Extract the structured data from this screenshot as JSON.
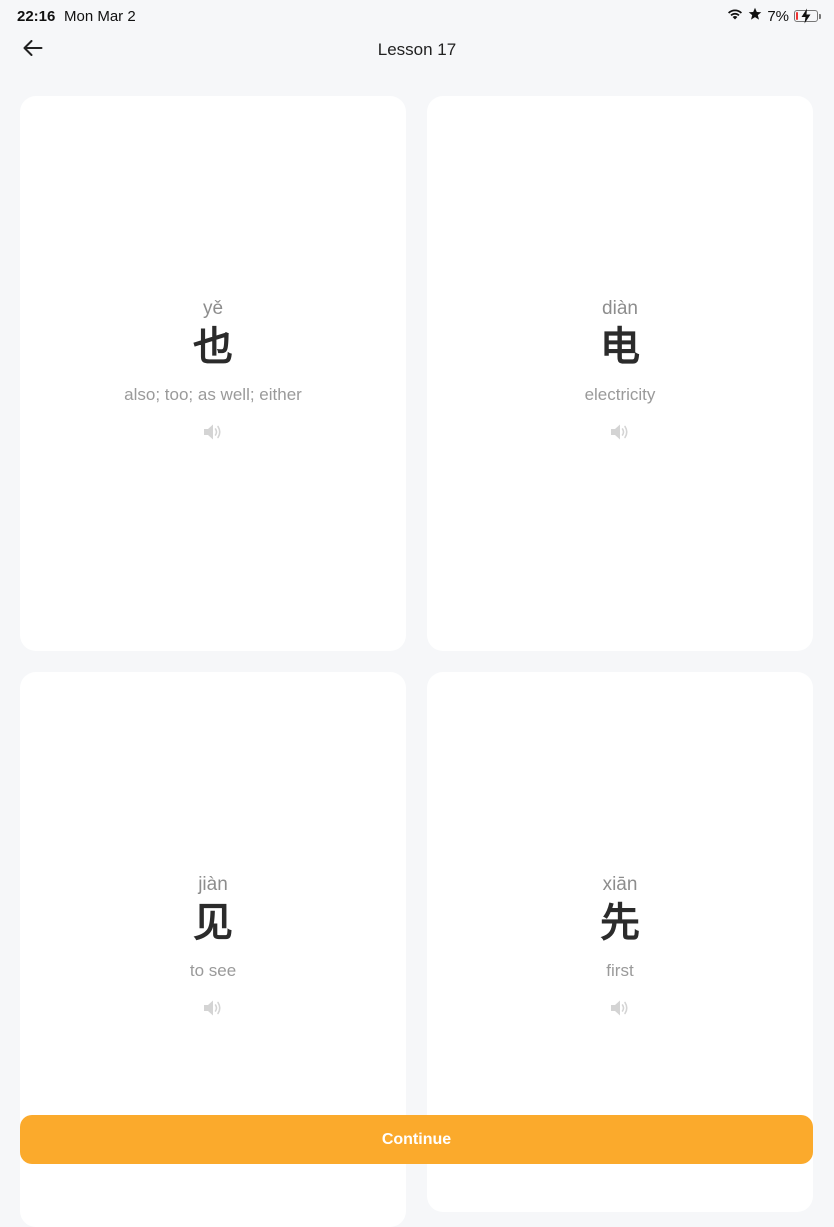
{
  "status_bar": {
    "time": "22:16",
    "date": "Mon Mar 2",
    "battery_percent": "7%",
    "icons": [
      "wifi-icon",
      "star-icon",
      "battery-charging-icon"
    ]
  },
  "nav": {
    "title": "Lesson 17",
    "back_icon": "back-arrow-icon"
  },
  "cards": [
    {
      "pinyin": "yě",
      "hanzi": "也",
      "meaning": "also; too; as well; either",
      "audio_icon": "speaker-icon"
    },
    {
      "pinyin": "diàn",
      "hanzi": "电",
      "meaning": "electricity",
      "audio_icon": "speaker-icon"
    },
    {
      "pinyin": "jiàn",
      "hanzi": "见",
      "meaning": "to see",
      "audio_icon": "speaker-icon"
    },
    {
      "pinyin": "xiān",
      "hanzi": "先",
      "meaning": "first",
      "audio_icon": "speaker-icon"
    }
  ],
  "continue_label": "Continue",
  "colors": {
    "accent": "#fbaa2c",
    "background": "#f6f7f9",
    "card": "#ffffff"
  }
}
